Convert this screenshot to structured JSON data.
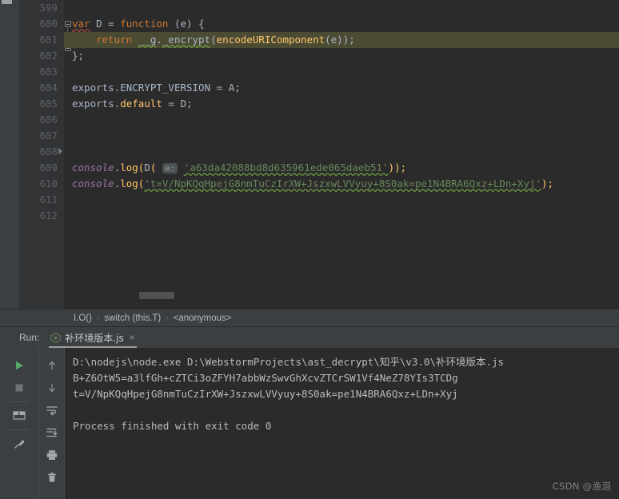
{
  "editor": {
    "first_line_number": 599,
    "lines": [
      {
        "n": 599,
        "text": ""
      },
      {
        "n": 600,
        "text": "var D = function (e) {"
      },
      {
        "n": 601,
        "text": "    return __g._encrypt(encodeURIComponent(e));"
      },
      {
        "n": 602,
        "text": "};"
      },
      {
        "n": 603,
        "text": ""
      },
      {
        "n": 604,
        "text": "exports.ENCRYPT_VERSION = A;"
      },
      {
        "n": 605,
        "text": "exports.default = D;"
      },
      {
        "n": 606,
        "text": ""
      },
      {
        "n": 607,
        "text": ""
      },
      {
        "n": 608,
        "text": ""
      },
      {
        "n": 609,
        "text": "console.log(D( e: 'a63da42088bd8d635961ede065daeb51'));"
      },
      {
        "n": 610,
        "text": "console.log('t=V/NpKQqHpejG8nmTuCzIrXW+JszxwLVVyuy+8S0ak=pe1N4BRA6Qxz+LDn+Xyj');"
      },
      {
        "n": 611,
        "text": ""
      },
      {
        "n": 612,
        "text": ""
      }
    ],
    "tokens": {
      "var": "var",
      "d_name": "D",
      "equals": "=",
      "function": "function",
      "paren_e": "(e) {",
      "return": "return",
      "g_obj": "__g",
      "dot": ".",
      "encrypt": "_encrypt",
      "open_paren": "(",
      "encodeURIComponent": "encodeURIComponent",
      "e_arg": "(e)",
      "close": ");",
      "close_brace": "};",
      "exports": "exports",
      "encrypt_version": "ENCRYPT_VERSION",
      "a_val": "A;",
      "default": "default",
      "d_val": "D;",
      "console": "console",
      "log": "log",
      "param_hint_e": "e:",
      "hash_string": "'a63da42088bd8d635961ede065daeb51'",
      "call_close_609": "));",
      "token_string": "'t=V/NpKQqHpejG8nmTuCzIrXW+JszxwLVVyuy+8S0ak=pe1N4BRA6Qxz+LDn+Xyj'",
      "call_close_610": ");"
    }
  },
  "breadcrumb": {
    "items": [
      "I.O()",
      "switch (this.T)",
      "<anonymous>"
    ],
    "separator": "›"
  },
  "run_panel": {
    "label": "Run:",
    "tab_title": "补环境版本.js",
    "tab_close": "×",
    "toolbar_left": [
      {
        "name": "rerun-button",
        "icon": "play-icon"
      },
      {
        "name": "stop-button",
        "icon": "stop-icon"
      },
      {
        "name": "layout-settings-button",
        "icon": "layout-icon"
      },
      {
        "name": "pin-tab-button",
        "icon": "pin-icon"
      }
    ],
    "toolbar_right": [
      {
        "name": "prev-occurrence-button",
        "icon": "arrow-up-icon"
      },
      {
        "name": "next-occurrence-button",
        "icon": "arrow-down-icon"
      },
      {
        "name": "soft-wrap-button",
        "icon": "soft-wrap-icon"
      },
      {
        "name": "scroll-to-end-button",
        "icon": "scroll-to-end-icon"
      },
      {
        "name": "print-button",
        "icon": "printer-icon"
      },
      {
        "name": "clear-all-button",
        "icon": "trash-icon"
      }
    ],
    "console": {
      "command_pre": "D:\\nodejs\\node.exe D:\\WebstormProjects\\ast_decrypt\\",
      "command_cn1": "知乎",
      "command_mid": "\\v3.0\\",
      "command_cn2": "补环境版本",
      "command_post": ".js",
      "out_line_1": "B+Z6OtW5=a3lfGh+cZTCi3oZFYH7abbWzSwvGhXcvZTCrSW1Vf4NeZ78YIs3TCDg",
      "out_line_2": "t=V/NpKQqHpejG8nmTuCzIrXW+JszxwLVVyuy+8S0ak=pe1N4BRA6Qxz+LDn+Xyj",
      "exit_line": "Process finished with exit code 0"
    }
  },
  "watermark": "CSDN @渔洄",
  "colors": {
    "editor_bg": "#2b2b2b",
    "gutter_bg": "#313335",
    "panel_bg": "#3c3f41",
    "keyword": "#cc7832",
    "string": "#6a8759",
    "function": "#ffc66d",
    "identifier": "#a9b7c6",
    "field": "#9876aa",
    "line_highlight": "#4b4b34",
    "run_green": "#59a869"
  }
}
